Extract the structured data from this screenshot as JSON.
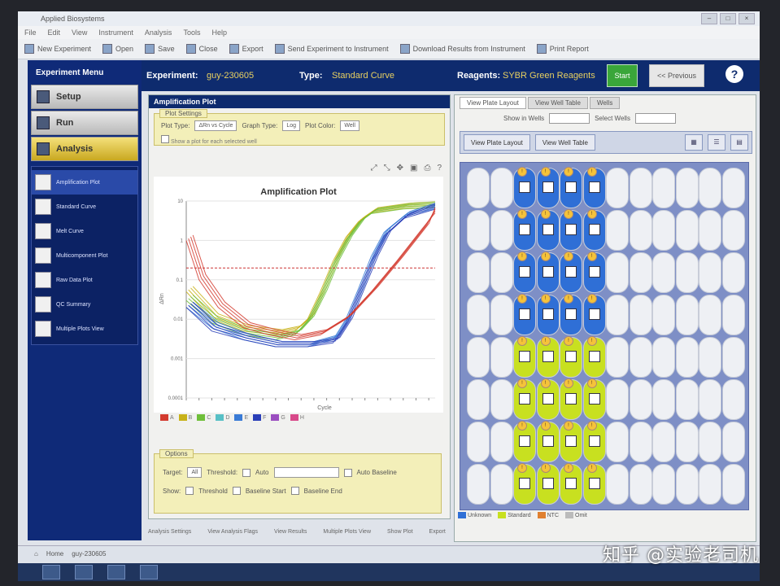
{
  "window": {
    "title": "Applied Biosystems"
  },
  "menubar": {
    "items": [
      "File",
      "Edit",
      "View",
      "Instrument",
      "Analysis",
      "Tools",
      "Help"
    ]
  },
  "toolbar": {
    "items": [
      "New Experiment",
      "Open",
      "Save",
      "Close",
      "Export",
      "Send Experiment to Instrument",
      "Download Results from Instrument",
      "Print Report"
    ]
  },
  "header": {
    "experiment_label": "Experiment:",
    "experiment_value": "guy-230605",
    "type_label": "Type:",
    "type_value": "Standard Curve",
    "reagents_label": "Reagents:",
    "reagents_value": "SYBR Green Reagents",
    "start_button": "Start",
    "nav_button": "<< Previous",
    "help_icon": "?"
  },
  "left_panel": {
    "title": "Experiment Menu",
    "steps": [
      "Setup",
      "Run",
      "Analysis"
    ],
    "plots": [
      "Amplification Plot",
      "Standard Curve",
      "Melt Curve",
      "Multicomponent Plot",
      "Raw Data Plot",
      "QC Summary",
      "Multiple Plots View"
    ]
  },
  "center_panel": {
    "title": "Amplification Plot",
    "settings_tab": "Plot Settings",
    "plot_type_label": "Plot Type:",
    "plot_type_value": "ΔRn vs Cycle",
    "graph_type_label": "Graph Type:",
    "graph_type_value": "Log",
    "plot_color_label": "Plot Color:",
    "plot_color_value": "Well",
    "note": "Show a plot for each selected well",
    "legend": [
      "A",
      "B",
      "C",
      "D",
      "E",
      "F",
      "G",
      "H"
    ],
    "legend_colors": [
      "#d33b2f",
      "#c8b21a",
      "#6fbf3a",
      "#58c0c6",
      "#3a7bd6",
      "#2a3fb8",
      "#9b4fc0",
      "#d84a8a"
    ],
    "options_tab": "Options",
    "target_label": "Target:",
    "target_value": "All",
    "threshold_label": "Threshold:",
    "threshold_value": "Auto",
    "auto_baseline": "Auto Baseline",
    "show_label": "Show:",
    "show_options": [
      "Threshold",
      "Baseline Start",
      "Baseline End"
    ]
  },
  "chart_data": {
    "type": "line",
    "title": "Amplification Plot",
    "xlabel": "Cycle",
    "ylabel": "ΔRn",
    "log_scale": true,
    "ylim": [
      0.0001,
      10
    ],
    "xlim": [
      1,
      40
    ],
    "yticks": [
      "10",
      "1",
      "0.1",
      "0.01",
      "0.001",
      "0.0001"
    ],
    "series": [
      {
        "color": "#c8b21a",
        "x": [
          1,
          5,
          10,
          15,
          18,
          20,
          22,
          24,
          26,
          28,
          30,
          35,
          40
        ],
        "y": [
          0.05,
          0.01,
          0.005,
          0.004,
          0.005,
          0.01,
          0.05,
          0.3,
          1.2,
          3,
          5,
          6.5,
          7
        ]
      },
      {
        "color": "#6fbf3a",
        "x": [
          1,
          5,
          10,
          15,
          18,
          20,
          22,
          24,
          26,
          28,
          30,
          35,
          40
        ],
        "y": [
          0.03,
          0.008,
          0.004,
          0.003,
          0.004,
          0.009,
          0.04,
          0.25,
          1,
          2.8,
          4.8,
          6.3,
          6.9
        ]
      },
      {
        "color": "#3a7bd6",
        "x": [
          1,
          5,
          10,
          15,
          20,
          24,
          26,
          28,
          30,
          32,
          35,
          40
        ],
        "y": [
          0.02,
          0.006,
          0.003,
          0.002,
          0.002,
          0.003,
          0.01,
          0.06,
          0.4,
          1.6,
          4,
          6.5
        ]
      },
      {
        "color": "#2a3fb8",
        "x": [
          1,
          5,
          10,
          15,
          20,
          24,
          26,
          28,
          30,
          32,
          35,
          40
        ],
        "y": [
          0.02,
          0.005,
          0.003,
          0.002,
          0.002,
          0.0025,
          0.008,
          0.05,
          0.3,
          1.3,
          3.6,
          6.2
        ]
      },
      {
        "color": "#d33b2f",
        "x": [
          1,
          3,
          6,
          10,
          14,
          18,
          22,
          26,
          30,
          34,
          38,
          40
        ],
        "y": [
          1,
          0.1,
          0.02,
          0.006,
          0.004,
          0.003,
          0.004,
          0.01,
          0.05,
          0.3,
          2,
          5
        ]
      }
    ]
  },
  "right_panel": {
    "tabs": [
      "View Plate Layout",
      "View Well Table",
      "Wells"
    ],
    "show_in_wells_label": "Show in Wells",
    "select_wells_label": "Select Wells",
    "plate_bar_btn1": "View Plate Layout",
    "plate_bar_btn2": "View Well Table",
    "legend": [
      "Unknown",
      "Standard",
      "NTC",
      "Omit"
    ]
  },
  "bottom_tabs": [
    "Analysis Settings",
    "View Analysis Flags",
    "View Results",
    "Multiple Plots View",
    "Show Plot",
    "Export"
  ],
  "statusbar": {
    "home": "Home",
    "experiment_tab": "guy-230605"
  },
  "watermark": "知乎 @实验老司机"
}
